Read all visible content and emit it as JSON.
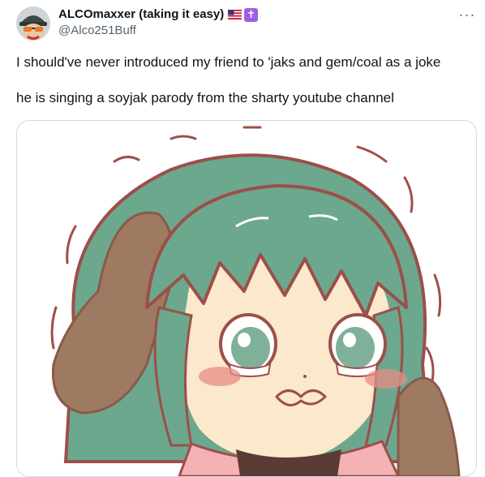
{
  "user": {
    "display_name": "ALCOmaxxer (taking it easy)",
    "handle": "@Alco251Buff",
    "badge_icon": "latin-cross-icon",
    "flag_icon": "us-flag-icon",
    "badge_symbol": "✝"
  },
  "menu": {
    "more_symbol": "···",
    "more_icon": "more-options-icon"
  },
  "tweet": {
    "paragraphs": [
      "I should've never introduced my friend to 'jaks and gem/coal as a joke",
      "he is singing a soyjak parody from the sharty youtube channel"
    ]
  },
  "media": {
    "description_icon": "anime-girl-crying-image",
    "colors": {
      "hair": "#6ca88d",
      "outline": "#9c4f4a",
      "skin": "#fce8cc",
      "ear": "#9f7a62",
      "blush": "#e58e86",
      "shirt": "#f4b2b5"
    }
  }
}
